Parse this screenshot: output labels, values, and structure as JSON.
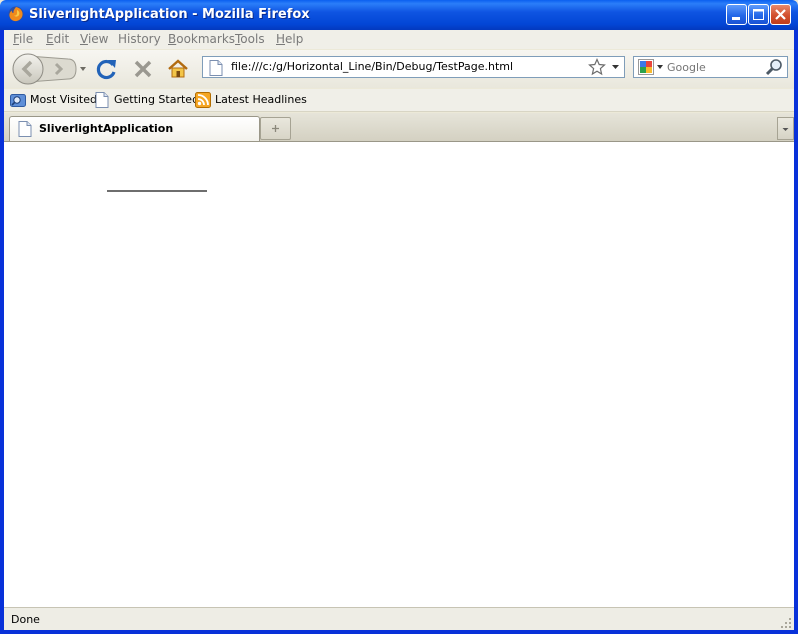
{
  "window": {
    "title": "SliverlightApplication - Mozilla Firefox"
  },
  "menu": {
    "items": [
      {
        "label": "File",
        "accel": "F",
        "rest": "ile"
      },
      {
        "label": "Edit",
        "accel": "E",
        "rest": "dit"
      },
      {
        "label": "View",
        "accel": "V",
        "rest": "iew"
      },
      {
        "label": "History",
        "accel": "",
        "rest": "History"
      },
      {
        "label": "Bookmarks",
        "accel": "B",
        "rest": "ookmarks"
      },
      {
        "label": "Tools",
        "accel": "T",
        "rest": "ools"
      },
      {
        "label": "Help",
        "accel": "H",
        "rest": "elp"
      }
    ]
  },
  "navigation": {
    "url": "file:///c:/g/Horizontal_Line/Bin/Debug/TestPage.html",
    "search_placeholder": "Google"
  },
  "bookmarks": {
    "items": [
      {
        "label": "Most Visited",
        "icon": "most-visited-icon"
      },
      {
        "label": "Getting Started",
        "icon": "page-icon"
      },
      {
        "label": "Latest Headlines",
        "icon": "rss-feed-icon"
      }
    ]
  },
  "tabs": {
    "items": [
      {
        "label": "SliverlightApplication",
        "active": true
      }
    ]
  },
  "content": {
    "elements": [
      {
        "type": "horizontal-line",
        "color": "#6e6e6e"
      }
    ]
  },
  "status": {
    "text": "Done"
  },
  "colors": {
    "titlebar": "#0346d6",
    "frame": "#0831d9",
    "toolbar": "#ece9d8"
  }
}
